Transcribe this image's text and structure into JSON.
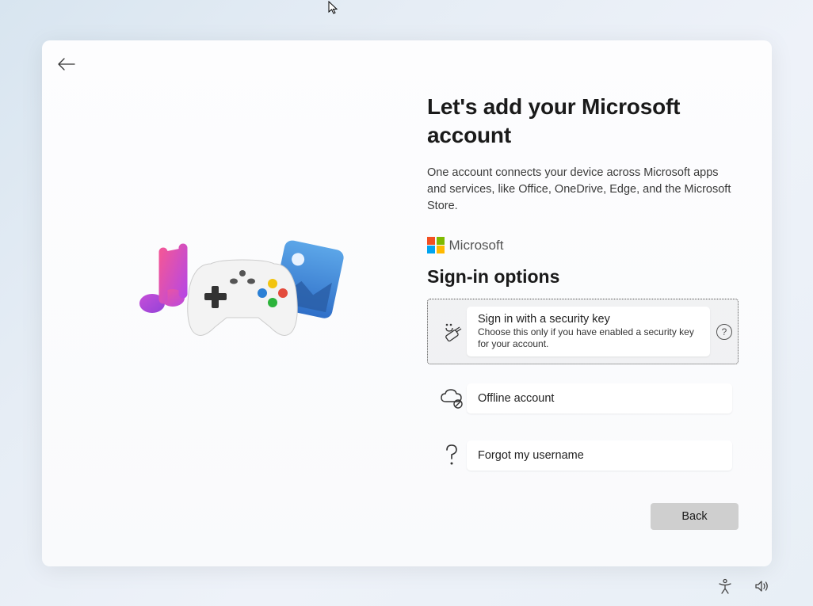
{
  "heading": "Let's add your Microsoft account",
  "subheading": "One account connects your device across Microsoft apps and services, like Office, OneDrive, Edge, and the Microsoft Store.",
  "brand_label": "Microsoft",
  "options_heading": "Sign-in options",
  "options": [
    {
      "title": "Sign in with a security key",
      "subtitle": "Choose this only if you have enabled a security key for your account.",
      "icon": "security-key-icon",
      "selected": true,
      "help": true
    },
    {
      "title": "Offline account",
      "subtitle": "",
      "icon": "cloud-offline-icon",
      "selected": false,
      "help": false
    },
    {
      "title": "Forgot my username",
      "subtitle": "",
      "icon": "question-icon",
      "selected": false,
      "help": false
    }
  ],
  "buttons": {
    "back": "Back"
  },
  "help_symbol": "?",
  "colors": {
    "ms_red": "#f25022",
    "ms_green": "#7fba00",
    "ms_blue": "#00a4ef",
    "ms_yellow": "#ffb900"
  }
}
